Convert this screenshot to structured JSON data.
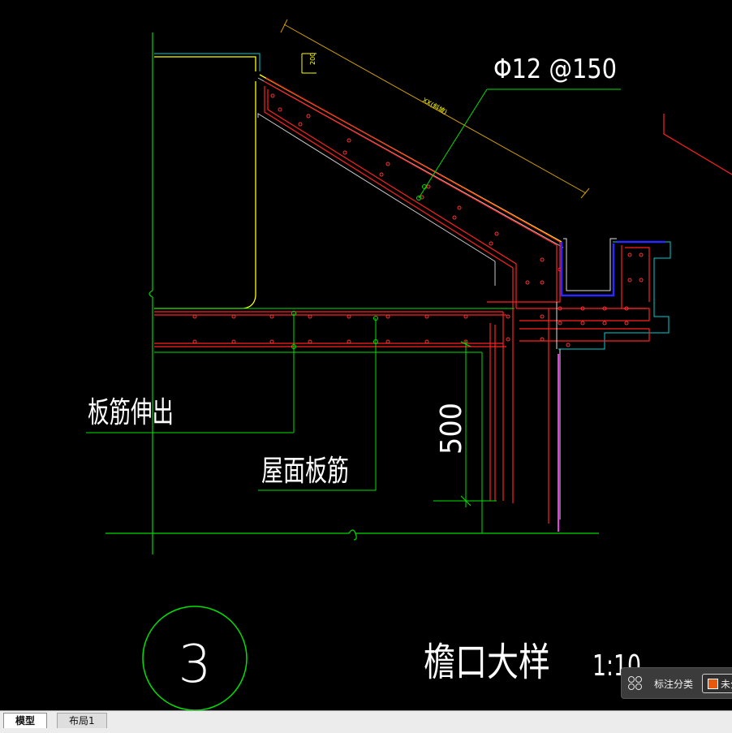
{
  "drawing": {
    "rebar_spec": "Φ12 @150",
    "dim_small": "200",
    "dim_slope": "XX(斜坡)",
    "label_extend": "板筋伸出",
    "label_roof": "屋面板筋",
    "dim_500": "500",
    "detail_number": "3",
    "detail_title": "檐口大样",
    "scale": "1:10"
  },
  "panel": {
    "label": "标注分类",
    "button_text": "未分类",
    "swatch_color": "#e8590c"
  },
  "tabs": [
    {
      "label": "模型"
    },
    {
      "label": "布局1"
    }
  ],
  "colors": {
    "background": "#000000",
    "green": "#00ff00",
    "red": "#ff0000",
    "yellow": "#ffff00",
    "blue": "#2a2aff",
    "white": "#ffffff"
  }
}
